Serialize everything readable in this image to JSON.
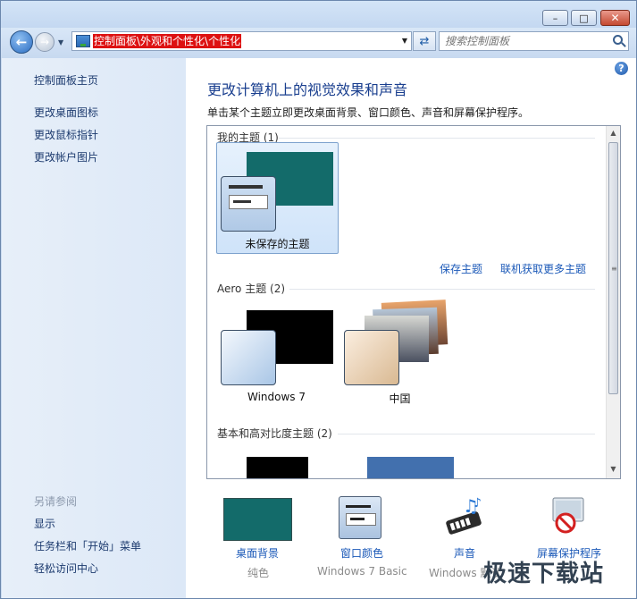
{
  "window": {
    "caption_buttons": {
      "minimize": "–",
      "maximize": "□",
      "close": "✕"
    }
  },
  "nav": {
    "address": "控制面板\\外观和个性化\\个性化",
    "search_placeholder": "搜索控制面板"
  },
  "sidebar": {
    "items": [
      {
        "label": "控制面板主页"
      },
      {
        "label": "更改桌面图标"
      },
      {
        "label": "更改鼠标指针"
      },
      {
        "label": "更改帐户图片"
      }
    ],
    "see_also_heading": "另请参阅",
    "see_also": [
      {
        "label": "显示"
      },
      {
        "label": "任务栏和「开始」菜单"
      },
      {
        "label": "轻松访问中心"
      }
    ]
  },
  "main": {
    "title": "更改计算机上的视觉效果和声音",
    "description": "单击某个主题立即更改桌面背景、窗口颜色、声音和屏幕保护程序。",
    "help": "?",
    "groups": {
      "my_themes": "我的主题 (1)",
      "aero": "Aero 主题 (2)",
      "basic": "基本和高对比度主题 (2)"
    },
    "themes": {
      "unsaved": "未保存的主题",
      "win7": "Windows 7",
      "china": "中国"
    },
    "links": {
      "save": "保存主题",
      "more": "联机获取更多主题"
    }
  },
  "bottom": [
    {
      "label": "桌面背景",
      "sub": "纯色"
    },
    {
      "label": "窗口颜色",
      "sub": "Windows 7 Basic"
    },
    {
      "label": "声音",
      "sub": "Windows 默认"
    },
    {
      "label": "屏幕保护程序",
      "sub": ""
    }
  ],
  "watermark": "极速下载站",
  "colors": {
    "teal_background": "#136b6a",
    "link_blue": "#1b59b8",
    "title_blue": "#1a3f8f",
    "address_highlight": "#dd1111"
  }
}
